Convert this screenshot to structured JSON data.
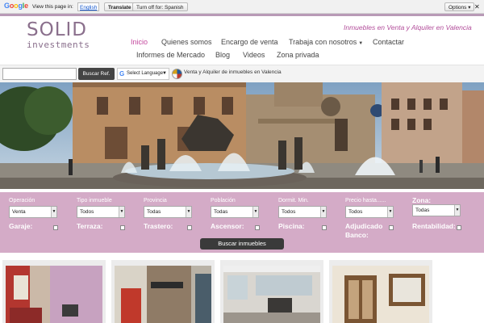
{
  "translate_bar": {
    "google": "Google",
    "view_text": "View this page in:",
    "language": "English",
    "translate_label": "Translate",
    "turn_off_label": "Turn off for: Spanish",
    "options_label": "Options ▾",
    "close_label": "✕"
  },
  "header": {
    "logo_top": "SOLID",
    "logo_bottom": "investments",
    "tagline": "Inmuebles en Venta y Alquiler en Valencia"
  },
  "nav": {
    "items": [
      {
        "label": "Inicio"
      },
      {
        "label": "Quienes somos"
      },
      {
        "label": "Encargo de venta"
      },
      {
        "label": "Trabaja con nosotros"
      },
      {
        "label": "Contactar"
      },
      {
        "label": "Informes de Mercado"
      },
      {
        "label": "Blog"
      },
      {
        "label": "Videos"
      },
      {
        "label": "Zona privada"
      }
    ]
  },
  "search_strip": {
    "ref_value": "",
    "ref_button": "Buscar Ref.",
    "select_language": "Select Language",
    "select_arrow": "▼",
    "tagline": "Venta y Alquiler de inmuebles en Valencia"
  },
  "filters": {
    "selects": [
      {
        "label": "Operación",
        "value": "Venta"
      },
      {
        "label": "Tipo inmueble",
        "value": "Todos"
      },
      {
        "label": "Provincia",
        "value": "Todas"
      },
      {
        "label": "Población",
        "value": "Todas"
      },
      {
        "label": "Dormit. Min.",
        "value": "Todos"
      },
      {
        "label": "Precio hasta......",
        "value": "Todos"
      },
      {
        "label": "Zona:",
        "value": "Todas"
      }
    ],
    "checkboxes": [
      {
        "label": "Garaje:"
      },
      {
        "label": "Terraza:"
      },
      {
        "label": "Trastero:"
      },
      {
        "label": "Ascensor:"
      },
      {
        "label": "Piscina:"
      },
      {
        "label": "Adjudicado Banco:"
      },
      {
        "label": "Rentabilidad:"
      }
    ],
    "search_button": "Buscar inmuebles"
  },
  "colors": {
    "brand_purple": "#8a6f8c",
    "accent_pink": "#c3489e",
    "filter_bg": "#d4abc7"
  }
}
